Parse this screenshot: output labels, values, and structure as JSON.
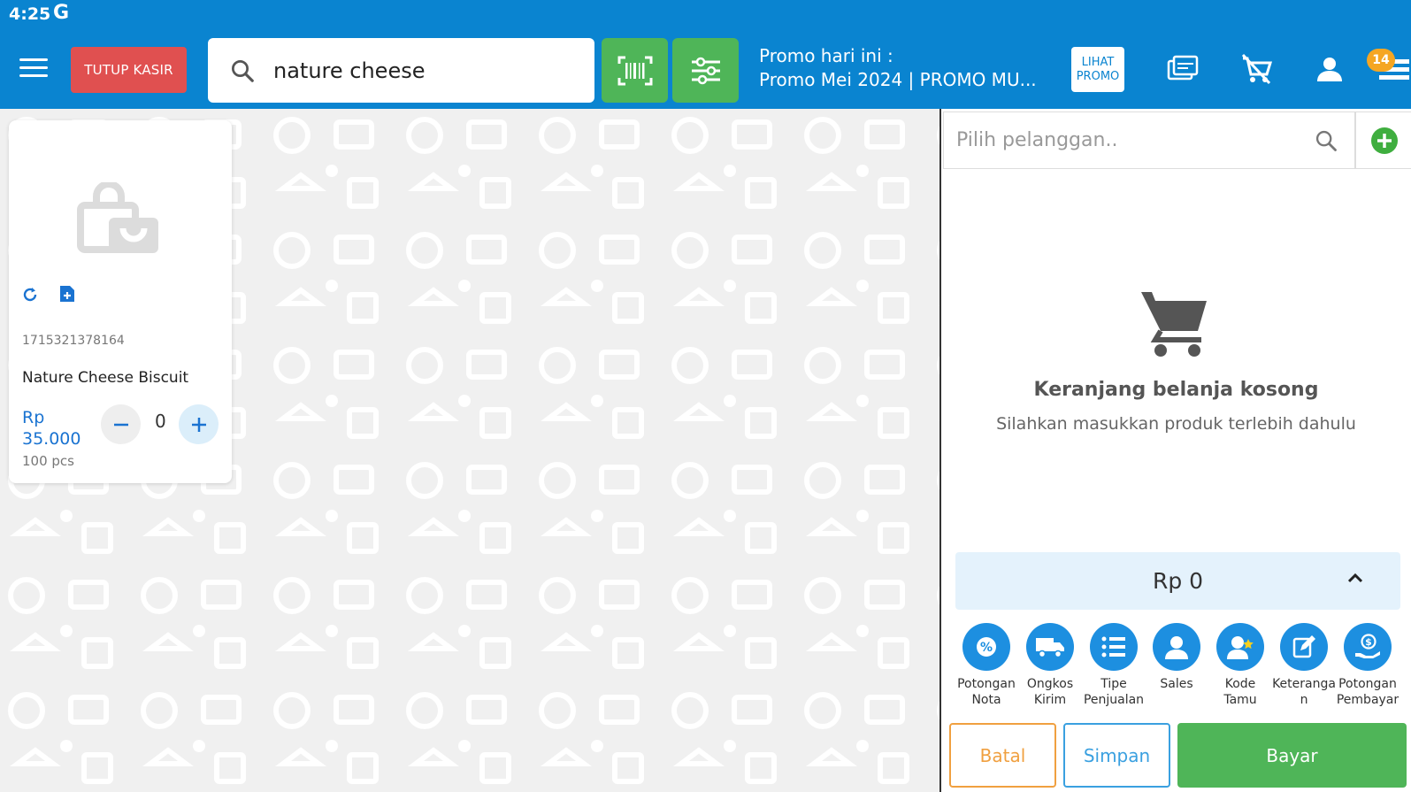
{
  "status_bar": {
    "time": "4:25",
    "g_logo": "G"
  },
  "header": {
    "tutup_kasir": "TUTUP KASIR",
    "search_value": "nature cheese",
    "promo_title": "Promo hari ini :",
    "promo_text": "Promo Mei 2024 | PROMO MU...",
    "lihat_promo_line1": "LIHAT",
    "lihat_promo_line2": "PROMO",
    "badge_count": "14",
    "icons": [
      "menu-icon",
      "barcode-icon",
      "filter-icon",
      "wallet-icon",
      "cart-cancel-icon",
      "user-icon",
      "list-icon"
    ]
  },
  "product": {
    "sku": "1715321378164",
    "name": "Nature Cheese Biscuit",
    "price_currency": "Rp",
    "price_value": "35.000",
    "stock": "100 pcs",
    "qty": "0"
  },
  "cart": {
    "customer_placeholder": "Pilih pelanggan..",
    "empty_title": "Keranjang belanja kosong",
    "empty_sub": "Silahkan masukkan produk terlebih dahulu",
    "total": "Rp 0",
    "actions": [
      {
        "line1": "Potongan",
        "line2": "Nota",
        "icon": "percent-tag-icon"
      },
      {
        "line1": "Ongkos",
        "line2": "Kirim",
        "icon": "truck-icon"
      },
      {
        "line1": "Tipe",
        "line2": "Penjualan",
        "icon": "list-icon"
      },
      {
        "line1": "Sales",
        "line2": "",
        "icon": "person-icon"
      },
      {
        "line1": "Kode",
        "line2": "Tamu",
        "icon": "guest-star-icon"
      },
      {
        "line1": "Keteranga",
        "line2": "n",
        "icon": "edit-note-icon"
      },
      {
        "line1": "Potongan",
        "line2": "Pembayar",
        "icon": "hand-coin-icon"
      }
    ],
    "batal": "Batal",
    "simpan": "Simpan",
    "bayar": "Bayar"
  },
  "colors": {
    "primary": "#0a84d0",
    "danger": "#e05050",
    "success": "#4fb558",
    "orange": "#f0a040",
    "action_blue": "#1d8fe0"
  }
}
